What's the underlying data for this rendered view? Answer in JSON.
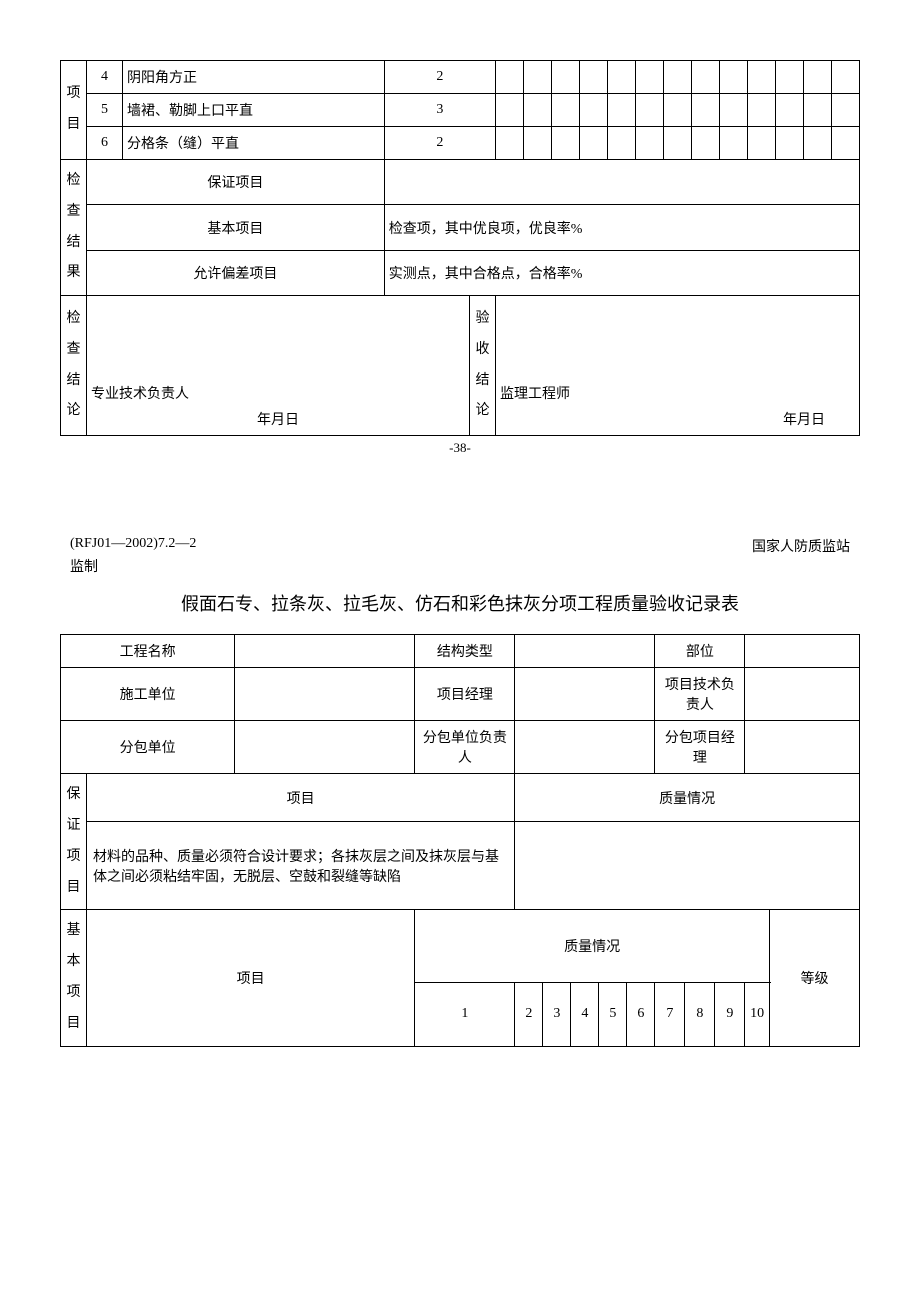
{
  "top_table": {
    "vlabel": "项目",
    "rows": [
      {
        "num": "4",
        "name": "阴阳角方正",
        "tol": "2"
      },
      {
        "num": "5",
        "name": "墙裙、勒脚上口平直",
        "tol": "3"
      },
      {
        "num": "6",
        "name": "分格条（缝）平直",
        "tol": "2"
      }
    ],
    "check_result_label": "检查结果",
    "guarantee_label": "保证项目",
    "basic_label": "基本项目",
    "basic_text": "检查项，其中优良项，优良率%",
    "deviation_label": "允许偏差项目",
    "deviation_text": "实测点，其中合格点，合格率%",
    "inspect_vlabel": "检查结论",
    "accept_vlabel": "验收结论",
    "tech_leader": "专业技术负责人",
    "supervisor": "监理工程师",
    "date": "年月日"
  },
  "page_number": "-38-",
  "doc_code": "(RFJ01—2002)7.2—2",
  "issuer_line1": "国家人防质监站",
  "issuer_line2": "监制",
  "title": "假面石专、拉条灰、拉毛灰、仿石和彩色抹灰分项工程质量验收记录表",
  "form2": {
    "project_name": "工程名称",
    "structure_type": "结构类型",
    "position": "部位",
    "construction_unit": "施工单位",
    "project_manager": "项目经理",
    "tech_leader": "项目技术负责人",
    "subcontract_unit": "分包单位",
    "subcontract_leader": "分包单位负责人",
    "subcontract_pm": "分包项目经理",
    "guarantee_vlabel": "保证项目",
    "item_header": "项目",
    "quality_header": "质量情况",
    "guarantee_text": "材料的品种、质量必须符合设计要求；各抹灰层之间及抹灰层与基体之间必须粘结牢固，无脱层、空鼓和裂缝等缺陷",
    "basic_vlabel": "基本项目",
    "grade_header": "等级",
    "nums": [
      "1",
      "2",
      "3",
      "4",
      "5",
      "6",
      "7",
      "8",
      "9",
      "10"
    ]
  }
}
